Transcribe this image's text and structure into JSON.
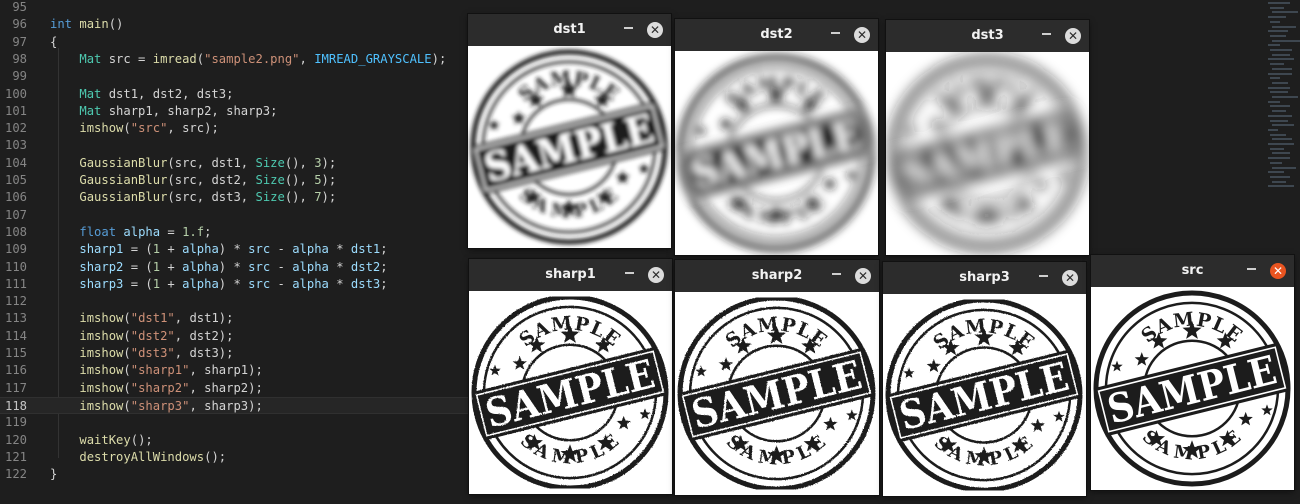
{
  "editor": {
    "current_line": "118",
    "lines": [
      {
        "n": "95",
        "tokens": []
      },
      {
        "n": "96",
        "tokens": [
          {
            "t": "int",
            "c": "kw"
          },
          {
            "t": " ",
            "c": "plain"
          },
          {
            "t": "main",
            "c": "fn"
          },
          {
            "t": "()",
            "c": "plain"
          }
        ]
      },
      {
        "n": "97",
        "tokens": [
          {
            "t": "{",
            "c": "plain"
          }
        ]
      },
      {
        "n": "98",
        "tokens": [
          {
            "t": "    ",
            "c": "plain"
          },
          {
            "t": "Mat",
            "c": "type"
          },
          {
            "t": " src = ",
            "c": "plain"
          },
          {
            "t": "imread",
            "c": "fn"
          },
          {
            "t": "(",
            "c": "plain"
          },
          {
            "t": "\"sample2.png\"",
            "c": "str"
          },
          {
            "t": ", ",
            "c": "plain"
          },
          {
            "t": "IMREAD_GRAYSCALE",
            "c": "enum"
          },
          {
            "t": ");",
            "c": "plain"
          }
        ]
      },
      {
        "n": "99",
        "tokens": []
      },
      {
        "n": "100",
        "tokens": [
          {
            "t": "    ",
            "c": "plain"
          },
          {
            "t": "Mat",
            "c": "type"
          },
          {
            "t": " dst1, dst2, dst3;",
            "c": "plain"
          }
        ]
      },
      {
        "n": "101",
        "tokens": [
          {
            "t": "    ",
            "c": "plain"
          },
          {
            "t": "Mat",
            "c": "type"
          },
          {
            "t": " sharp1, sharp2, sharp3;",
            "c": "plain"
          }
        ]
      },
      {
        "n": "102",
        "tokens": [
          {
            "t": "    ",
            "c": "plain"
          },
          {
            "t": "imshow",
            "c": "fn"
          },
          {
            "t": "(",
            "c": "plain"
          },
          {
            "t": "\"src\"",
            "c": "str"
          },
          {
            "t": ", src);",
            "c": "plain"
          }
        ]
      },
      {
        "n": "103",
        "tokens": []
      },
      {
        "n": "104",
        "tokens": [
          {
            "t": "    ",
            "c": "plain"
          },
          {
            "t": "GaussianBlur",
            "c": "fn"
          },
          {
            "t": "(src, dst1, ",
            "c": "plain"
          },
          {
            "t": "Size",
            "c": "type"
          },
          {
            "t": "(), ",
            "c": "plain"
          },
          {
            "t": "3",
            "c": "num"
          },
          {
            "t": ");",
            "c": "plain"
          }
        ]
      },
      {
        "n": "105",
        "tokens": [
          {
            "t": "    ",
            "c": "plain"
          },
          {
            "t": "GaussianBlur",
            "c": "fn"
          },
          {
            "t": "(src, dst2, ",
            "c": "plain"
          },
          {
            "t": "Size",
            "c": "type"
          },
          {
            "t": "(), ",
            "c": "plain"
          },
          {
            "t": "5",
            "c": "num"
          },
          {
            "t": ");",
            "c": "plain"
          }
        ]
      },
      {
        "n": "106",
        "tokens": [
          {
            "t": "    ",
            "c": "plain"
          },
          {
            "t": "GaussianBlur",
            "c": "fn"
          },
          {
            "t": "(src, dst3, ",
            "c": "plain"
          },
          {
            "t": "Size",
            "c": "type"
          },
          {
            "t": "(), ",
            "c": "plain"
          },
          {
            "t": "7",
            "c": "num"
          },
          {
            "t": ");",
            "c": "plain"
          }
        ]
      },
      {
        "n": "107",
        "tokens": []
      },
      {
        "n": "108",
        "tokens": [
          {
            "t": "    ",
            "c": "plain"
          },
          {
            "t": "float",
            "c": "kw"
          },
          {
            "t": " ",
            "c": "plain"
          },
          {
            "t": "alpha",
            "c": "var"
          },
          {
            "t": " = ",
            "c": "plain"
          },
          {
            "t": "1.f",
            "c": "num"
          },
          {
            "t": ";",
            "c": "plain"
          }
        ]
      },
      {
        "n": "109",
        "tokens": [
          {
            "t": "    ",
            "c": "plain"
          },
          {
            "t": "sharp1",
            "c": "var"
          },
          {
            "t": " = (",
            "c": "plain"
          },
          {
            "t": "1",
            "c": "num"
          },
          {
            "t": " + ",
            "c": "plain"
          },
          {
            "t": "alpha",
            "c": "var"
          },
          {
            "t": ") * ",
            "c": "plain"
          },
          {
            "t": "src",
            "c": "var"
          },
          {
            "t": " - ",
            "c": "plain"
          },
          {
            "t": "alpha",
            "c": "var"
          },
          {
            "t": " * ",
            "c": "plain"
          },
          {
            "t": "dst1",
            "c": "var"
          },
          {
            "t": ";",
            "c": "plain"
          }
        ]
      },
      {
        "n": "110",
        "tokens": [
          {
            "t": "    ",
            "c": "plain"
          },
          {
            "t": "sharp2",
            "c": "var"
          },
          {
            "t": " = (",
            "c": "plain"
          },
          {
            "t": "1",
            "c": "num"
          },
          {
            "t": " + ",
            "c": "plain"
          },
          {
            "t": "alpha",
            "c": "var"
          },
          {
            "t": ") * ",
            "c": "plain"
          },
          {
            "t": "src",
            "c": "var"
          },
          {
            "t": " - ",
            "c": "plain"
          },
          {
            "t": "alpha",
            "c": "var"
          },
          {
            "t": " * ",
            "c": "plain"
          },
          {
            "t": "dst2",
            "c": "var"
          },
          {
            "t": ";",
            "c": "plain"
          }
        ]
      },
      {
        "n": "111",
        "tokens": [
          {
            "t": "    ",
            "c": "plain"
          },
          {
            "t": "sharp3",
            "c": "var"
          },
          {
            "t": " = (",
            "c": "plain"
          },
          {
            "t": "1",
            "c": "num"
          },
          {
            "t": " + ",
            "c": "plain"
          },
          {
            "t": "alpha",
            "c": "var"
          },
          {
            "t": ") * ",
            "c": "plain"
          },
          {
            "t": "src",
            "c": "var"
          },
          {
            "t": " - ",
            "c": "plain"
          },
          {
            "t": "alpha",
            "c": "var"
          },
          {
            "t": " * ",
            "c": "plain"
          },
          {
            "t": "dst3",
            "c": "var"
          },
          {
            "t": ";",
            "c": "plain"
          }
        ]
      },
      {
        "n": "112",
        "tokens": []
      },
      {
        "n": "113",
        "tokens": [
          {
            "t": "    ",
            "c": "plain"
          },
          {
            "t": "imshow",
            "c": "fn"
          },
          {
            "t": "(",
            "c": "plain"
          },
          {
            "t": "\"dst1\"",
            "c": "str"
          },
          {
            "t": ", dst1);",
            "c": "plain"
          }
        ]
      },
      {
        "n": "114",
        "tokens": [
          {
            "t": "    ",
            "c": "plain"
          },
          {
            "t": "imshow",
            "c": "fn"
          },
          {
            "t": "(",
            "c": "plain"
          },
          {
            "t": "\"dst2\"",
            "c": "str"
          },
          {
            "t": ", dst2);",
            "c": "plain"
          }
        ]
      },
      {
        "n": "115",
        "tokens": [
          {
            "t": "    ",
            "c": "plain"
          },
          {
            "t": "imshow",
            "c": "fn"
          },
          {
            "t": "(",
            "c": "plain"
          },
          {
            "t": "\"dst3\"",
            "c": "str"
          },
          {
            "t": ", dst3);",
            "c": "plain"
          }
        ]
      },
      {
        "n": "116",
        "tokens": [
          {
            "t": "    ",
            "c": "plain"
          },
          {
            "t": "imshow",
            "c": "fn"
          },
          {
            "t": "(",
            "c": "plain"
          },
          {
            "t": "\"sharp1\"",
            "c": "str"
          },
          {
            "t": ", sharp1);",
            "c": "plain"
          }
        ]
      },
      {
        "n": "117",
        "tokens": [
          {
            "t": "    ",
            "c": "plain"
          },
          {
            "t": "imshow",
            "c": "fn"
          },
          {
            "t": "(",
            "c": "plain"
          },
          {
            "t": "\"sharp2\"",
            "c": "str"
          },
          {
            "t": ", sharp2);",
            "c": "plain"
          }
        ]
      },
      {
        "n": "118",
        "tokens": [
          {
            "t": "    ",
            "c": "plain"
          },
          {
            "t": "imshow",
            "c": "fn"
          },
          {
            "t": "(",
            "c": "plain"
          },
          {
            "t": "\"sharp3\"",
            "c": "str"
          },
          {
            "t": ", sharp3);",
            "c": "plain"
          }
        ]
      },
      {
        "n": "119",
        "tokens": []
      },
      {
        "n": "120",
        "tokens": [
          {
            "t": "    ",
            "c": "plain"
          },
          {
            "t": "waitKey",
            "c": "fn"
          },
          {
            "t": "();",
            "c": "plain"
          }
        ]
      },
      {
        "n": "121",
        "tokens": [
          {
            "t": "    ",
            "c": "plain"
          },
          {
            "t": "destroyAllWindows",
            "c": "fn"
          },
          {
            "t": "();",
            "c": "plain"
          }
        ]
      },
      {
        "n": "122",
        "tokens": [
          {
            "t": "}",
            "c": "plain"
          }
        ]
      }
    ]
  },
  "windows": [
    {
      "id": "dst1",
      "title": "dst1",
      "blur": 2.2,
      "sharp": false,
      "active": false
    },
    {
      "id": "dst2",
      "title": "dst2",
      "blur": 4.2,
      "sharp": false,
      "active": false
    },
    {
      "id": "dst3",
      "title": "dst3",
      "blur": 6.5,
      "sharp": false,
      "active": false
    },
    {
      "id": "sharp1",
      "title": "sharp1",
      "blur": 0,
      "sharp": true,
      "active": false
    },
    {
      "id": "sharp2",
      "title": "sharp2",
      "blur": 0,
      "sharp": true,
      "active": false
    },
    {
      "id": "sharp3",
      "title": "sharp3",
      "blur": 0,
      "sharp": true,
      "active": false
    },
    {
      "id": "src",
      "title": "src",
      "blur": 0,
      "sharp": false,
      "active": true
    }
  ],
  "window_controls": {
    "minimize_glyph": "–",
    "close_glyph": "✕"
  },
  "stamp": {
    "top_text": "SAMPLE",
    "band_text": "SAMPLE",
    "bottom_text": "SAMPLE",
    "ink_color": "#1c1c1c",
    "paper_color": "#ffffff"
  },
  "colors": {
    "editor_bg": "#1e1e1e",
    "titlebar_bg": "#2c2c2c",
    "close_active": "#e95420"
  }
}
